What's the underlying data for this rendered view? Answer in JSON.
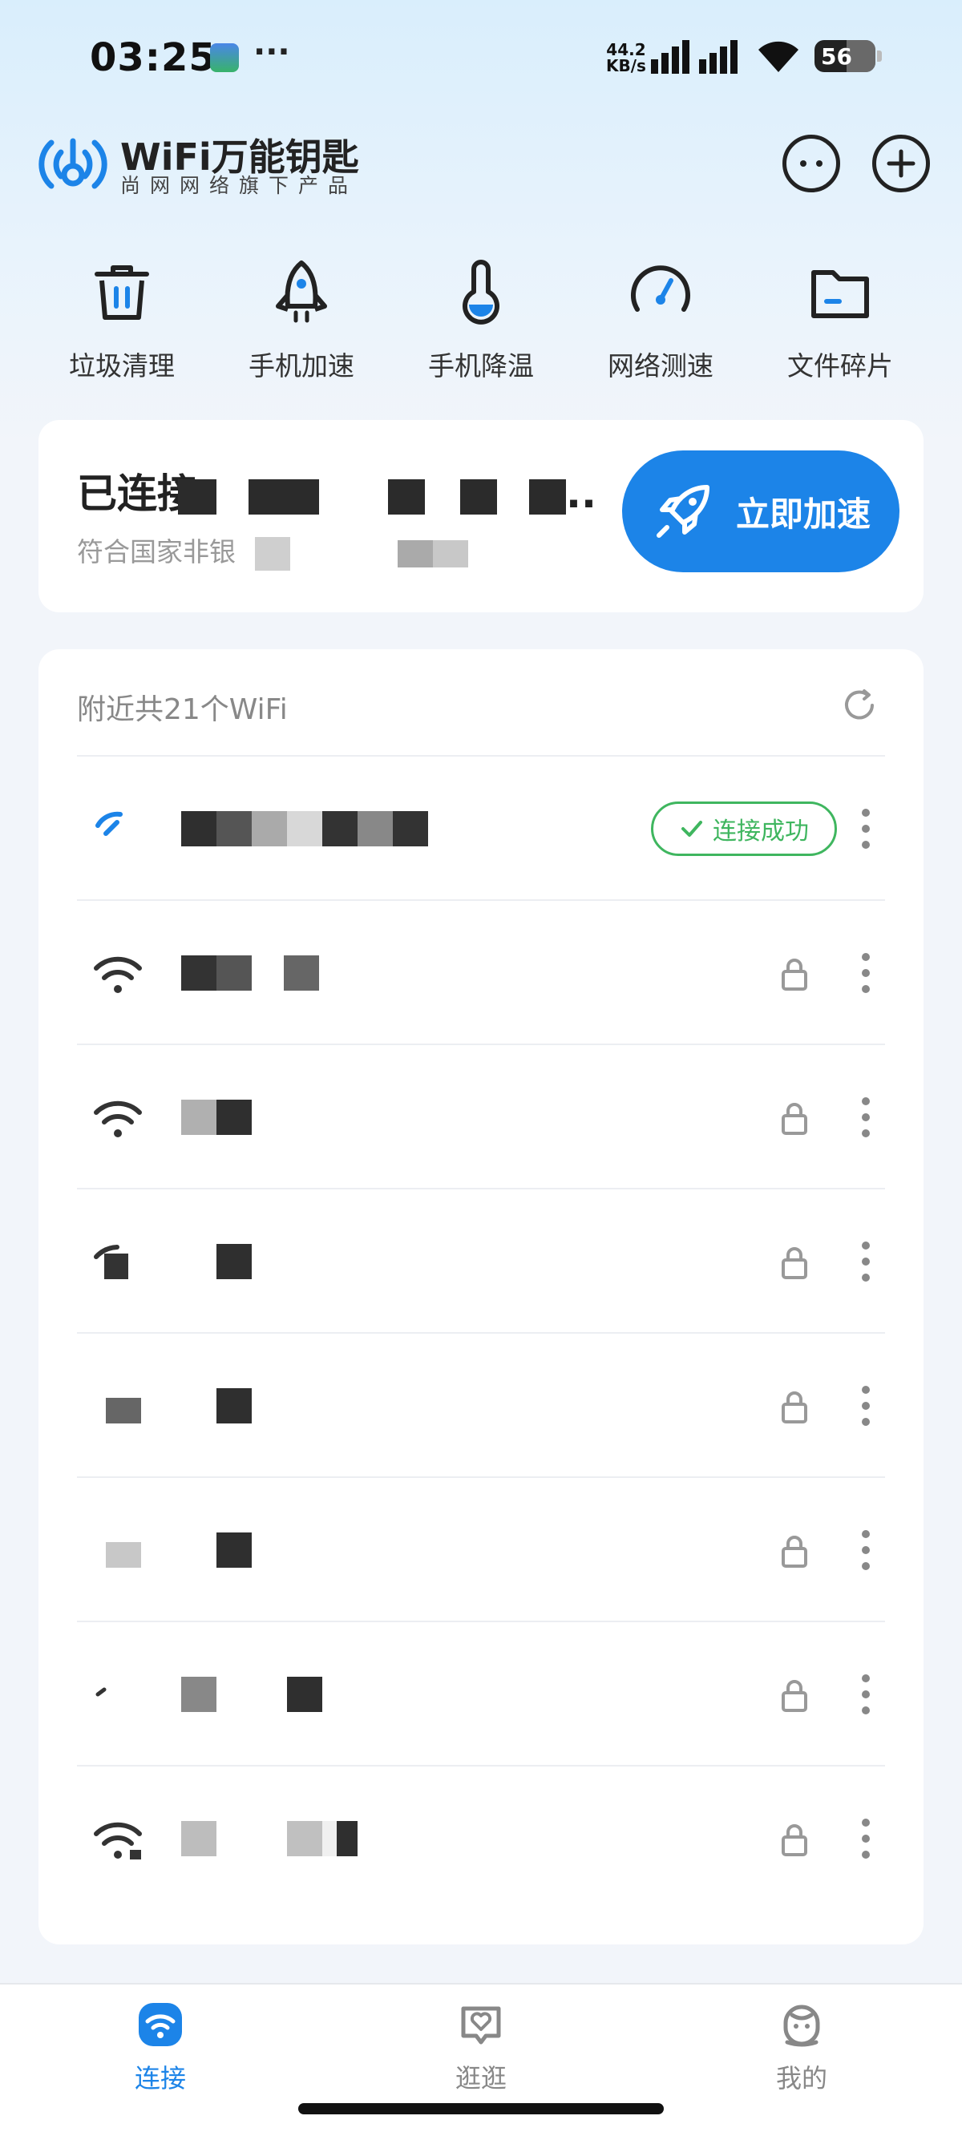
{
  "status_bar": {
    "time": "03:25",
    "more": "···",
    "net_speed_value": "44.2",
    "net_speed_unit": "KB/s",
    "battery": "56"
  },
  "header": {
    "brand": "WiFi万能钥匙",
    "subtitle": "尚网网络旗下产品"
  },
  "tools": [
    {
      "label": "垃圾清理",
      "icon": "trash-icon"
    },
    {
      "label": "手机加速",
      "icon": "rocket-icon"
    },
    {
      "label": "手机降温",
      "icon": "thermometer-icon"
    },
    {
      "label": "网络测速",
      "icon": "speedometer-icon"
    },
    {
      "label": "文件碎片",
      "icon": "folder-icon"
    }
  ],
  "connected": {
    "title_prefix": "已连接",
    "title_suffix": "..",
    "desc_prefix": "符合国家非银",
    "button_label": "立即加速"
  },
  "nearby": {
    "header": "附近共21个WiFi",
    "connected_badge": "连接成功",
    "rows": [
      {
        "status": "connected"
      },
      {
        "status": "locked"
      },
      {
        "status": "locked"
      },
      {
        "status": "locked"
      },
      {
        "status": "locked"
      },
      {
        "status": "locked"
      },
      {
        "status": "locked"
      },
      {
        "status": "locked"
      }
    ]
  },
  "tabs": [
    {
      "label": "连接",
      "active": true
    },
    {
      "label": "逛逛",
      "active": false
    },
    {
      "label": "我的",
      "active": false
    }
  ],
  "colors": {
    "accent": "#1c84e8",
    "success": "#3fb65f"
  }
}
